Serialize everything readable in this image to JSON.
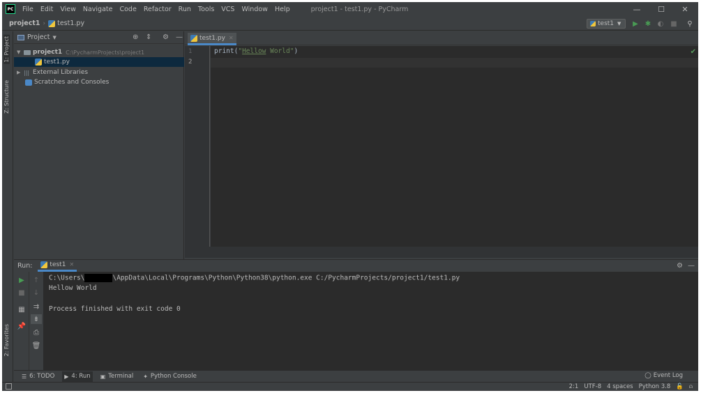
{
  "window": {
    "title": "project1 - test1.py - PyCharm",
    "app_logo": "PC"
  },
  "menu": [
    {
      "label": "File"
    },
    {
      "label": "Edit"
    },
    {
      "label": "View"
    },
    {
      "label": "Navigate"
    },
    {
      "label": "Code"
    },
    {
      "label": "Refactor"
    },
    {
      "label": "Run"
    },
    {
      "label": "Tools"
    },
    {
      "label": "VCS"
    },
    {
      "label": "Window"
    },
    {
      "label": "Help"
    }
  ],
  "navbar": {
    "project": "project1",
    "file": "test1.py",
    "run_config": "test1"
  },
  "left_strip": {
    "project_tab": "1: Project",
    "structure_tab": "Z: Structure",
    "favorites_tab": "2: Favorites"
  },
  "project_panel": {
    "header": "Project",
    "tree": {
      "project_name": "project1",
      "project_path": "C:\\PycharmProjects\\project1",
      "file": "test1.py",
      "external_libraries": "External Libraries",
      "scratches": "Scratches and Consoles"
    }
  },
  "editor": {
    "tab": "test1.py",
    "line_numbers": [
      "1",
      "2"
    ],
    "code_prefix": "print(",
    "code_string_open": "\"",
    "code_string_word": "Hellow",
    "code_string_rest": " World\"",
    "code_suffix": ")"
  },
  "run_panel": {
    "label": "Run:",
    "tab": "test1",
    "console": {
      "cmd_prefix": "C:\\Users\\",
      "cmd_suffix": "\\AppData\\Local\\Programs\\Python\\Python38\\python.exe C:/PycharmProjects/project1/test1.py",
      "output": "Hellow World",
      "exit_message": "Process finished with exit code 0"
    }
  },
  "bottom_tools": {
    "todo": "6: TODO",
    "run": "4: Run",
    "terminal": "Terminal",
    "python_console": "Python Console",
    "event_log": "Event Log"
  },
  "status_bar": {
    "position": "2:1",
    "encoding": "UTF-8",
    "indent": "4 spaces",
    "interpreter": "Python 3.8"
  }
}
